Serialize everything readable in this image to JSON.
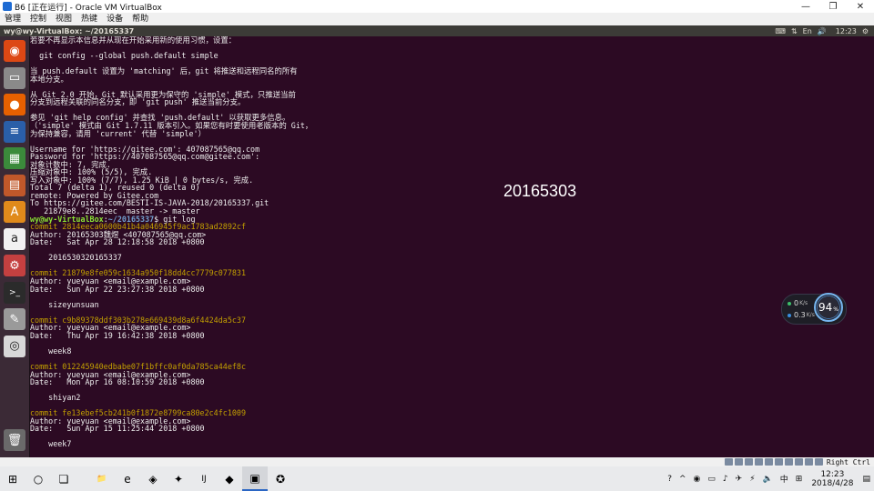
{
  "window": {
    "title": "B6 [正在运行] - Oracle VM VirtualBox",
    "minimize_glyph": "—",
    "restore_glyph": "❐",
    "close_glyph": "✕"
  },
  "vbox_menu": [
    "管理",
    "控制",
    "视图",
    "热键",
    "设备",
    "帮助"
  ],
  "ubuntu_panel": {
    "title": "wy@wy-VirtualBox: ~/20165337",
    "indicators": [
      "⌨",
      "⇅",
      "En",
      "🔊"
    ],
    "time": "12:23",
    "power_glyph": "⚙"
  },
  "launcher_icons": [
    {
      "name": "ubuntu-logo-icon",
      "glyph": "◉",
      "color": "#dd4814"
    },
    {
      "name": "files-icon",
      "glyph": "▭",
      "color": "#8a8a8a"
    },
    {
      "name": "firefox-icon",
      "glyph": "●",
      "color": "#e66000"
    },
    {
      "name": "writer-icon",
      "glyph": "≡",
      "color": "#2a5fa8"
    },
    {
      "name": "calc-icon",
      "glyph": "▦",
      "color": "#3b8a3b"
    },
    {
      "name": "impress-icon",
      "glyph": "▤",
      "color": "#c0582a"
    },
    {
      "name": "software-center-icon",
      "glyph": "A",
      "color": "#e08a1b"
    },
    {
      "name": "amazon-icon",
      "glyph": "a",
      "color": "#f2f2f2"
    },
    {
      "name": "settings-icon",
      "glyph": "⚙",
      "color": "#c44040"
    },
    {
      "name": "terminal-icon",
      "glyph": ">_",
      "color": "#2b2b2b"
    },
    {
      "name": "text-editor-icon",
      "glyph": "✎",
      "color": "#9a9a9a"
    },
    {
      "name": "dvd-icon",
      "glyph": "◎",
      "color": "#d8d8d8"
    }
  ],
  "trash_icon": {
    "name": "trash-icon",
    "glyph": "🗑",
    "color": "#6a6a6a"
  },
  "terminal_lines": [
    {
      "text": "若要不再显示本信息并从现在开始采用新的使用习惯，设置："
    },
    {
      "text": ""
    },
    {
      "text": "  git config --global push.default simple"
    },
    {
      "text": ""
    },
    {
      "text": "当 push.default 设置为 'matching' 后，git 将推送和远程同名的所有"
    },
    {
      "text": "本地分支。"
    },
    {
      "text": ""
    },
    {
      "text": "从 Git 2.0 开始，Git 默认采用更为保守的 'simple' 模式，只推送当前"
    },
    {
      "text": "分支到远程关联的同名分支，即 'git push' 推送当前分支。"
    },
    {
      "text": ""
    },
    {
      "text": "参见 'git help config' 并查找 'push.default' 以获取更多信息。"
    },
    {
      "text": "（'simple' 模式由 Git 1.7.11 版本引入。如果您有时要使用老版本的 Git，"
    },
    {
      "text": "为保持兼容，请用 'current' 代替 'simple'）"
    },
    {
      "text": ""
    },
    {
      "text": "Username for 'https://gitee.com': 407087565@qq.com"
    },
    {
      "text": "Password for 'https://407087565@qq.com@gitee.com':"
    },
    {
      "text": "对象计数中: 7, 完成."
    },
    {
      "text": "压缩对象中: 100% (5/5), 完成."
    },
    {
      "text": "写入对象中: 100% (7/7), 1.25 KiB | 0 bytes/s, 完成."
    },
    {
      "text": "Total 7 (delta 1), reused 0 (delta 0)"
    },
    {
      "text": "remote: Powered by Gitee.com"
    },
    {
      "text": "To https://gitee.com/BESTI-IS-JAVA-2018/20165337.git"
    },
    {
      "text": "   21879e8..2814eec  master -> master"
    },
    {
      "kind": "prompt",
      "user": "wy@wy-VirtualBox",
      "sep": ":",
      "path": "~/20165337",
      "cmd": "$ git log"
    },
    {
      "text": "commit 2814eeca0600b41b4a046945f9ac1783ad2892cf",
      "kind": "commit"
    },
    {
      "text": "Author: 20165303魏煜 <407087565@qq.com>"
    },
    {
      "text": "Date:   Sat Apr 28 12:18:58 2018 +0800"
    },
    {
      "text": ""
    },
    {
      "text": "    2016530320165337"
    },
    {
      "text": ""
    },
    {
      "text": "commit 21879e8fe059c1634a950f18dd4cc7779c077831",
      "kind": "commit"
    },
    {
      "text": "Author: yueyuan <email@example.com>"
    },
    {
      "text": "Date:   Sun Apr 22 23:27:38 2018 +0800"
    },
    {
      "text": ""
    },
    {
      "text": "    sizeyunsuan"
    },
    {
      "text": ""
    },
    {
      "text": "commit c9b89378ddf303b278e669439d8a6f4424da5c37",
      "kind": "commit"
    },
    {
      "text": "Author: yueyuan <email@example.com>"
    },
    {
      "text": "Date:   Thu Apr 19 16:42:38 2018 +0800"
    },
    {
      "text": ""
    },
    {
      "text": "    week8"
    },
    {
      "text": ""
    },
    {
      "text": "commit 012245940edbabe07f1bffc0af0da785ca44ef8c",
      "kind": "commit"
    },
    {
      "text": "Author: yueyuan <email@example.com>"
    },
    {
      "text": "Date:   Mon Apr 16 08:10:59 2018 +0800"
    },
    {
      "text": ""
    },
    {
      "text": "    shiyan2"
    },
    {
      "text": ""
    },
    {
      "text": "commit fe13ebef5cb241b0f1872e8799ca80e2c4fc1009",
      "kind": "commit"
    },
    {
      "text": "Author: yueyuan <email@example.com>"
    },
    {
      "text": "Date:   Sun Apr 15 11:25:44 2018 +0800"
    },
    {
      "text": ""
    },
    {
      "text": "    week7"
    }
  ],
  "overlay_text": "20165303",
  "net_widget": {
    "up_value": "0",
    "up_unit": "K/s",
    "down_value": "0.3",
    "down_unit": "K/s",
    "up_color": "#3cbf6a",
    "down_color": "#3a8fe0"
  },
  "gauge": {
    "value": "94",
    "unit": "%"
  },
  "vbox_status": {
    "host_key": "Right Ctrl"
  },
  "taskbar_items": [
    {
      "name": "start-button",
      "glyph": "⊞"
    },
    {
      "name": "search-circle-icon",
      "glyph": "○"
    },
    {
      "name": "task-view-icon",
      "glyph": "❏"
    },
    {
      "name": "file-explorer-icon",
      "glyph": "📁"
    },
    {
      "name": "edge-icon",
      "glyph": "e"
    },
    {
      "name": "app-icon-1",
      "glyph": "◈"
    },
    {
      "name": "app-icon-2",
      "glyph": "✦"
    },
    {
      "name": "intellij-icon",
      "glyph": "IJ"
    },
    {
      "name": "app-icon-3",
      "glyph": "◆"
    },
    {
      "name": "virtualbox-icon",
      "glyph": "▣",
      "active": true
    },
    {
      "name": "app-icon-4",
      "glyph": "✪"
    }
  ],
  "tray": {
    "indicators": [
      "?",
      "^",
      "◉",
      "▭",
      "♪",
      "✈",
      "⚡",
      "🔈",
      "中",
      "⊞"
    ],
    "time": "12:23",
    "date": "2018/4/28",
    "notification_glyph": "▤"
  }
}
